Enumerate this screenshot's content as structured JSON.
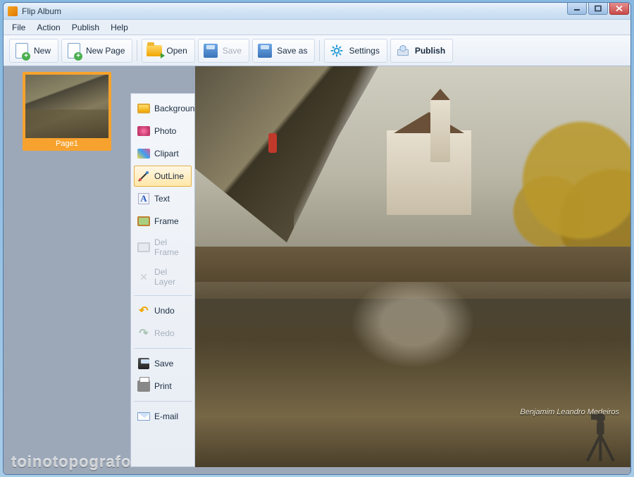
{
  "window": {
    "title": "Flip Album"
  },
  "menu": {
    "items": [
      "File",
      "Action",
      "Publish",
      "Help"
    ]
  },
  "toolbar": {
    "new": "New",
    "new_page": "New Page",
    "open": "Open",
    "save": "Save",
    "save_as": "Save as",
    "settings": "Settings",
    "publish": "Publish"
  },
  "thumbnail": {
    "label": "Page1"
  },
  "rail": {
    "background": "Background",
    "photo": "Photo",
    "clipart": "Clipart",
    "outline": "OutLine",
    "text": "Text",
    "frame": "Frame",
    "del_frame": "Del Frame",
    "del_layer": "Del Layer",
    "undo": "Undo",
    "redo": "Redo",
    "save": "Save",
    "print": "Print",
    "email": "E-mail"
  },
  "canvas": {
    "signature": "Benjamim Leandro Medeiros"
  },
  "watermark": "toinotopografo"
}
